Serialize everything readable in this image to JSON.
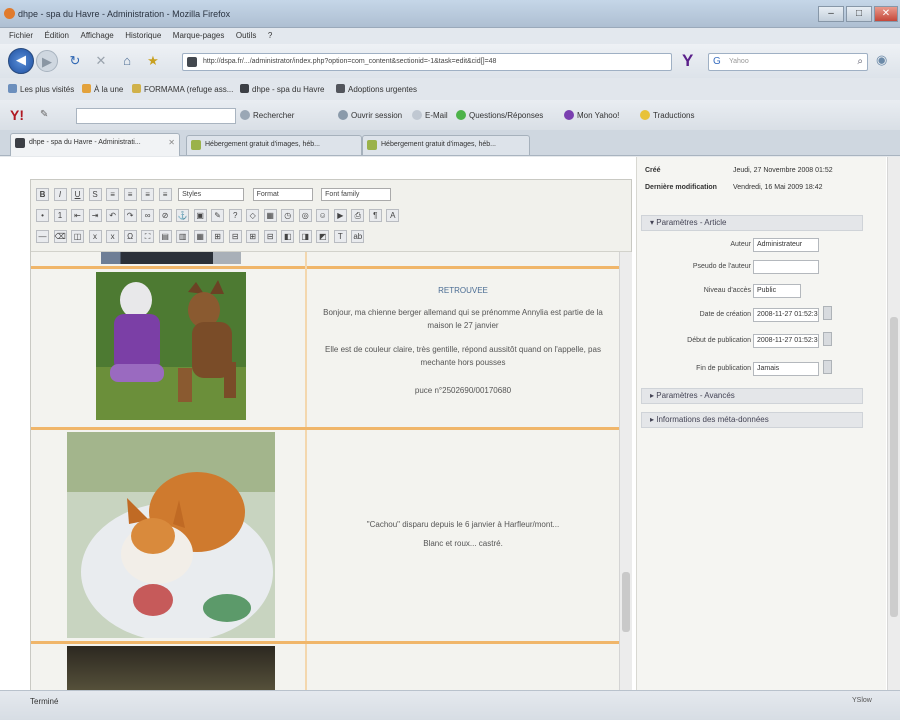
{
  "window": {
    "title": "dhpe - spa du Havre - Administration - Mozilla Firefox",
    "controls": {
      "minimize": "–",
      "maximize": "□",
      "close": "✕"
    }
  },
  "menu": [
    "Fichier",
    "Édition",
    "Affichage",
    "Historique",
    "Marque-pages",
    "Outils",
    "?"
  ],
  "nav": {
    "url": "http://dspa.fr/.../administrator/index.php?option=com_content&sectionid=-1&task=edit&cid[]=48",
    "search_placeholder": "Yahoo"
  },
  "bookmarks": [
    "Les plus visités",
    "À la une",
    "FORMAMA (refuge ass...",
    "dhpe - spa du Havre",
    "Adoptions urgentes"
  ],
  "yahoo_toolbar": {
    "items": [
      "Rechercher",
      "Ouvrir session",
      "E-Mail",
      "Questions/Réponses",
      "Mon Yahoo!",
      "Traductions"
    ]
  },
  "tabs": [
    {
      "label": "dhpe - spa du Havre - Administrati...",
      "active": true
    },
    {
      "label": "Hébergement gratuit d'images, héb...",
      "active": false
    },
    {
      "label": "Hébergement gratuit d'images, héb...",
      "active": false
    }
  ],
  "editor": {
    "toolbar": {
      "style_select": "Styles",
      "format_select": "Format",
      "font_select": "Font family"
    },
    "rows": [
      {
        "title": "RETROUVEE",
        "lines": [
          "Bonjour, ma chienne berger allemand qui se prénomme Annylia est partie de la maison le 27 janvier",
          "Elle est de couleur claire, très gentille, répond aussitôt quand on l'appelle, pas mechante hors pousses",
          "puce n°2502690/00170680"
        ]
      },
      {
        "title": "",
        "lines": [
          "\"Cachou\" disparu depuis le 6 janvier à Harfleur/mont...",
          "Blanc et roux... castré."
        ]
      }
    ]
  },
  "side": {
    "meta": [
      {
        "label": "Créé",
        "value": "Jeudi, 27 Novembre 2008 01:52"
      },
      {
        "label": "Dernière modification",
        "value": "Vendredi, 16 Mai 2009 18:42"
      }
    ],
    "sections": {
      "article": "Paramètres - Article",
      "advanced": "Paramètres - Avancés",
      "metadata": "Informations des méta-données"
    },
    "params": [
      {
        "label": "Auteur",
        "value": "Administrateur",
        "cal": false
      },
      {
        "label": "Pseudo de l'auteur",
        "value": "",
        "cal": false
      },
      {
        "label": "Niveau d'accès",
        "value": "Public",
        "cal": false
      },
      {
        "label": "Date de création",
        "value": "2008-11-27 01:52:3",
        "cal": true
      },
      {
        "label": "Début de publication",
        "value": "2008-11-27 01:52:3",
        "cal": true
      },
      {
        "label": "Fin de publication",
        "value": "Jamais",
        "cal": true
      }
    ]
  },
  "status": {
    "text": "Terminé",
    "yslow": "YSlow"
  }
}
